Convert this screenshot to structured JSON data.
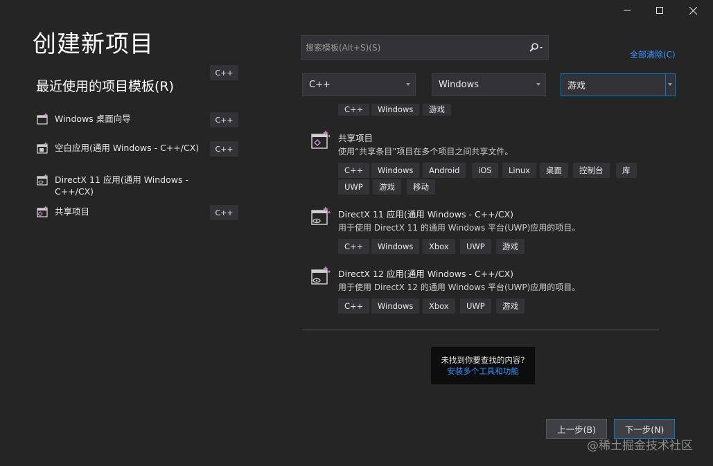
{
  "window": {
    "minimize_icon": "minimize-icon",
    "maximize_icon": "maximize-icon",
    "close_icon": "close-icon"
  },
  "header": {
    "title": "创建新项目"
  },
  "recent": {
    "title": "最近使用的项目模板(R)",
    "items": [
      {
        "label": "Windows 桌面向导",
        "tag": "C++",
        "icon": "windows-desktop-wizard-icon"
      },
      {
        "label": "空白应用(通用 Windows - C++/CX)",
        "tag": "C++",
        "icon": "blank-app-icon"
      },
      {
        "label": "DirectX 11 应用(通用 Windows - C++/CX)",
        "tag": "C++",
        "icon": "directx-app-icon"
      },
      {
        "label": "共享项目",
        "tag": "C++",
        "icon": "shared-project-icon"
      }
    ]
  },
  "search": {
    "placeholder": "搜索模板(Alt+S)(S)",
    "value": ""
  },
  "clear_all": "全部清除(C)",
  "filters": {
    "language": "C++",
    "platform": "Windows",
    "project_type": "游戏"
  },
  "results": {
    "partial_tags": [
      "C++",
      "Windows",
      "游戏"
    ],
    "templates": [
      {
        "title": "共享项目",
        "description": "使用“共享条目”项目在多个项目之间共享文件。",
        "tags": [
          "C++",
          "Windows",
          "Android",
          "iOS",
          "Linux",
          "桌面",
          "控制台",
          "库",
          "UWP",
          "游戏",
          "移动"
        ]
      },
      {
        "title": "DirectX 11 应用(通用 Windows - C++/CX)",
        "description": "用于使用 DirectX 11 的通用 Windows 平台(UWP)应用的项目。",
        "tags": [
          "C++",
          "Windows",
          "Xbox",
          "UWP",
          "游戏"
        ]
      },
      {
        "title": "DirectX 12 应用(通用 Windows - C++/CX)",
        "description": "用于使用 DirectX 12 的通用 Windows 平台(UWP)应用的项目。",
        "tags": [
          "C++",
          "Windows",
          "Xbox",
          "UWP",
          "游戏"
        ]
      }
    ]
  },
  "not_found": {
    "text": "未找到你要查找的内容?",
    "link": "安装多个工具和功能"
  },
  "footer": {
    "back": "上一步(B)",
    "next": "下一步(N)"
  },
  "watermark": "@稀土掘金技术社区",
  "colors": {
    "background": "#252526",
    "accent": "#007acc",
    "link": "#3794ff"
  }
}
